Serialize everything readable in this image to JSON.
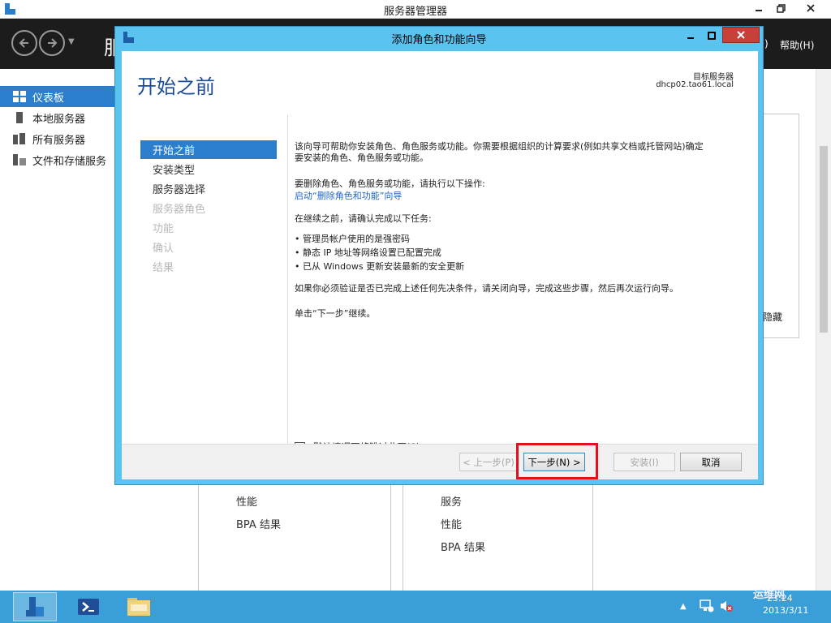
{
  "server_manager": {
    "window_title": "服务器管理器",
    "header_title_partial": "服",
    "help_menu": "帮助(H)",
    "menu_fragment": ")",
    "nav_items": [
      {
        "label": "仪表板",
        "selected": true,
        "icon": "dashboard-icon"
      },
      {
        "label": "本地服务器",
        "selected": false,
        "icon": "server-icon"
      },
      {
        "label": "所有服务器",
        "selected": false,
        "icon": "servers-icon"
      },
      {
        "label": "文件和存储服务",
        "selected": false,
        "icon": "storage-icon"
      }
    ],
    "hide_label": "隐藏",
    "tile1": {
      "items": [
        "性能",
        "BPA 结果"
      ]
    },
    "tile2": {
      "items": [
        "服务",
        "性能",
        "BPA 结果"
      ]
    }
  },
  "wizard": {
    "title": "添加角色和功能向导",
    "heading": "开始之前",
    "target_label": "目标服务器",
    "target_value": "dhcp02.tao61.local",
    "steps": [
      {
        "label": "开始之前",
        "state": "active"
      },
      {
        "label": "安装类型",
        "state": "enabled"
      },
      {
        "label": "服务器选择",
        "state": "enabled"
      },
      {
        "label": "服务器角色",
        "state": "disabled"
      },
      {
        "label": "功能",
        "state": "disabled"
      },
      {
        "label": "确认",
        "state": "disabled"
      },
      {
        "label": "结果",
        "state": "disabled"
      }
    ],
    "content": {
      "intro_line1": "该向导可帮助你安装角色、角色服务或功能。你需要根据组织的计算要求(例如共享文档或托管网站)确定",
      "intro_line2": "要安装的角色、角色服务或功能。",
      "remove_prompt": "要删除角色、角色服务或功能，请执行以下操作:",
      "remove_link": "启动“删除角色和功能”向导",
      "confirm_prompt": "在继续之前，请确认完成以下任务:",
      "bullets": [
        "管理员帐户使用的是强密码",
        "静态 IP 地址等网络设置已配置完成",
        "已从 Windows 更新安装最新的安全更新"
      ],
      "verify_note": "如果你必须验证是否已完成上述任何先决条件，请关闭向导，完成这些步骤，然后再次运行向导。",
      "click_next": "单击“下一步”继续。"
    },
    "skip_checkbox": {
      "label": "默认情况下将跳过此页(S)",
      "checked": false
    },
    "buttons": {
      "prev": "< 上一步(P)",
      "next": "下一步(N) >",
      "install": "安装(I)",
      "cancel": "取消"
    }
  },
  "taskbar": {
    "time": "23:24",
    "date": "2013/3/11",
    "watermark": "运维网"
  },
  "colors": {
    "accent": "#2a7ecb",
    "wizard_frame": "#5ac3f0",
    "taskbar": "#3a9fd9",
    "highlight": "#e01020",
    "heading": "#1a4b9b"
  }
}
